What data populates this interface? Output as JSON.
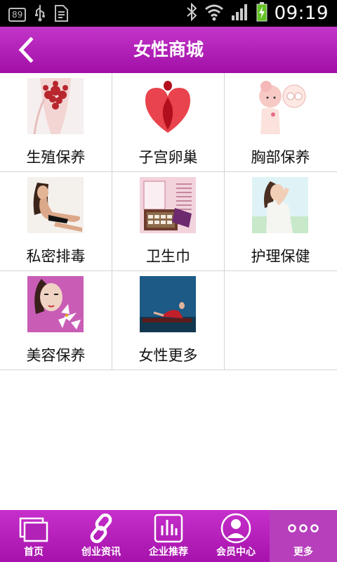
{
  "status_bar": {
    "time": "09:19",
    "notification_badge": "89"
  },
  "header": {
    "title": "女性商城"
  },
  "grid": [
    {
      "label": "生殖保养",
      "icon": "rose-petals-image"
    },
    {
      "label": "子宫卵巢",
      "icon": "uterus-heart-image"
    },
    {
      "label": "胸部保养",
      "icon": "breast-care-cartoon-image"
    },
    {
      "label": "私密排毒",
      "icon": "woman-lounging-image"
    },
    {
      "label": "卫生巾",
      "icon": "sanitary-product-box-image"
    },
    {
      "label": "护理保健",
      "icon": "woman-portrait-image"
    },
    {
      "label": "美容保养",
      "icon": "woman-with-lilies-image"
    },
    {
      "label": "女性更多",
      "icon": "woman-on-bench-image"
    }
  ],
  "nav": [
    {
      "label": "首页",
      "icon": "home-windows-icon"
    },
    {
      "label": "创业资讯",
      "icon": "chain-link-icon"
    },
    {
      "label": "企业推荐",
      "icon": "bar-chart-icon"
    },
    {
      "label": "会员中心",
      "icon": "user-icon"
    },
    {
      "label": "更多",
      "icon": "more-dots-icon"
    }
  ],
  "colors": {
    "brand": "#b11bb6",
    "status_bar": "#000000"
  }
}
